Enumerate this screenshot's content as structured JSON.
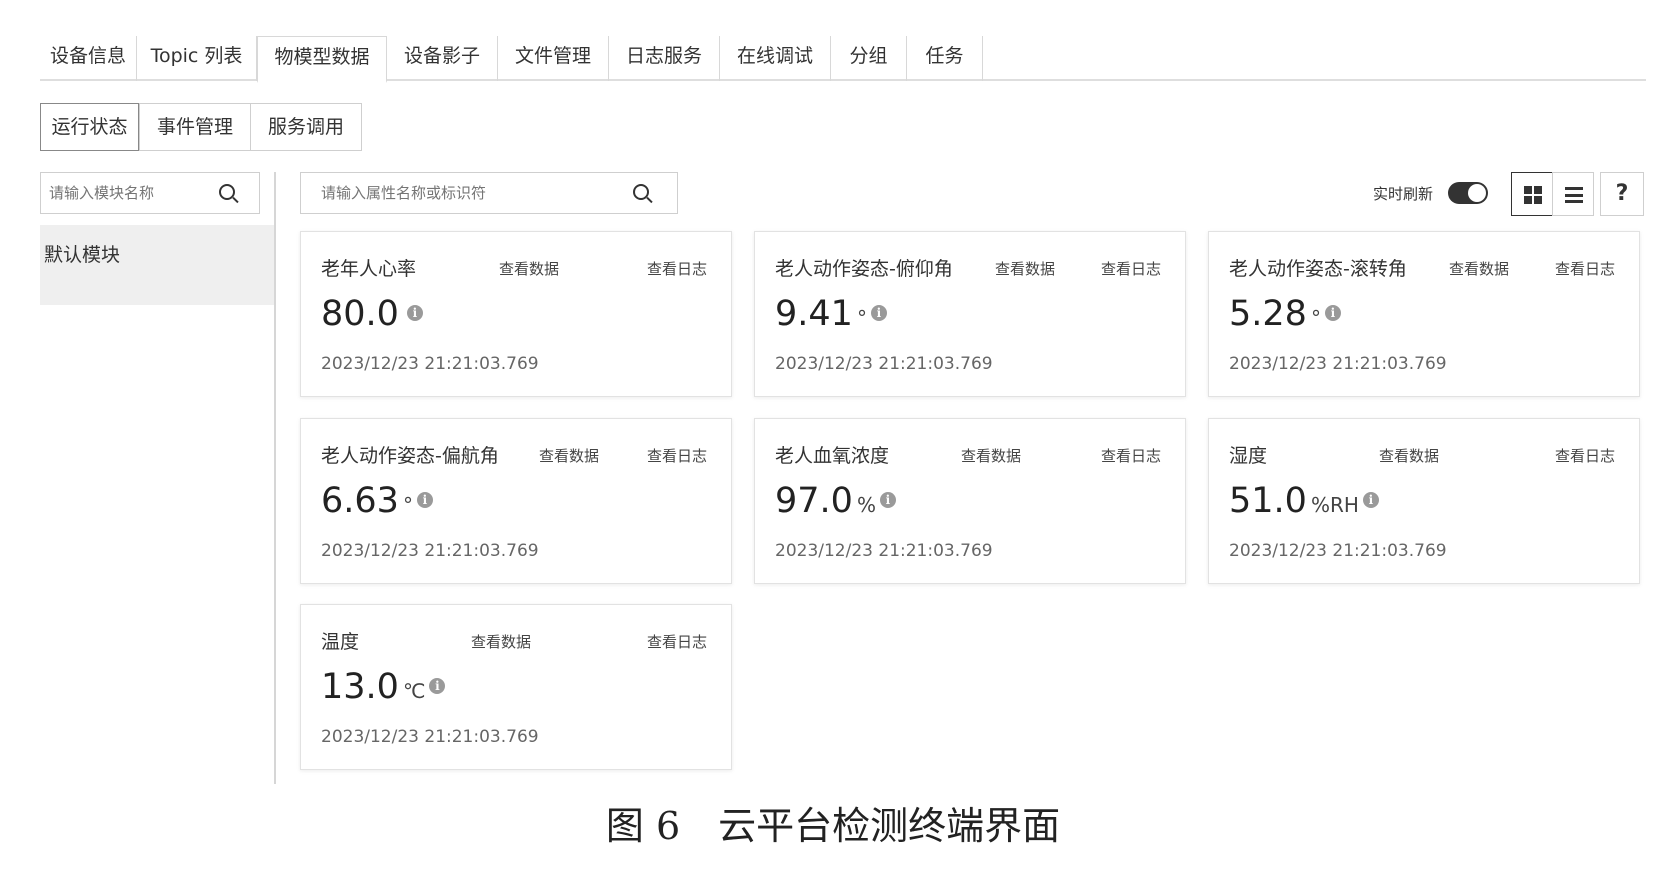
{
  "top_tabs": [
    "设备信息",
    "Topic 列表",
    "物模型数据",
    "设备影子",
    "文件管理",
    "日志服务",
    "在线调试",
    "分组",
    "任务"
  ],
  "sub_tabs": [
    "运行状态",
    "事件管理",
    "服务调用"
  ],
  "module_search": {
    "placeholder": "请输入模块名称"
  },
  "modules": [
    "默认模块"
  ],
  "property_search": {
    "placeholder": "请输入属性名称或标识符"
  },
  "controls": {
    "realtime_label": "实时刷新",
    "realtime_on": true,
    "help": "?"
  },
  "card_links": {
    "view_data": "查看数据",
    "view_log": "查看日志"
  },
  "cards": [
    {
      "name": "老年人心率",
      "value": "80.0",
      "unit": "",
      "time": "2023/12/23 21:21:03.769"
    },
    {
      "name": "老人动作姿态-俯仰角",
      "value": "9.41",
      "unit": "°",
      "time": "2023/12/23 21:21:03.769"
    },
    {
      "name": "老人动作姿态-滚转角",
      "value": "5.28",
      "unit": "°",
      "time": "2023/12/23 21:21:03.769"
    },
    {
      "name": "老人动作姿态-偏航角",
      "value": "6.63",
      "unit": "°",
      "time": "2023/12/23 21:21:03.769"
    },
    {
      "name": "老人血氧浓度",
      "value": "97.0",
      "unit": "%",
      "time": "2023/12/23 21:21:03.769"
    },
    {
      "name": "湿度",
      "value": "51.0",
      "unit": "%RH",
      "time": "2023/12/23 21:21:03.769"
    },
    {
      "name": "温度",
      "value": "13.0",
      "unit": "℃",
      "time": "2023/12/23 21:21:03.769"
    }
  ],
  "caption": "图 6　云平台检测终端界面"
}
